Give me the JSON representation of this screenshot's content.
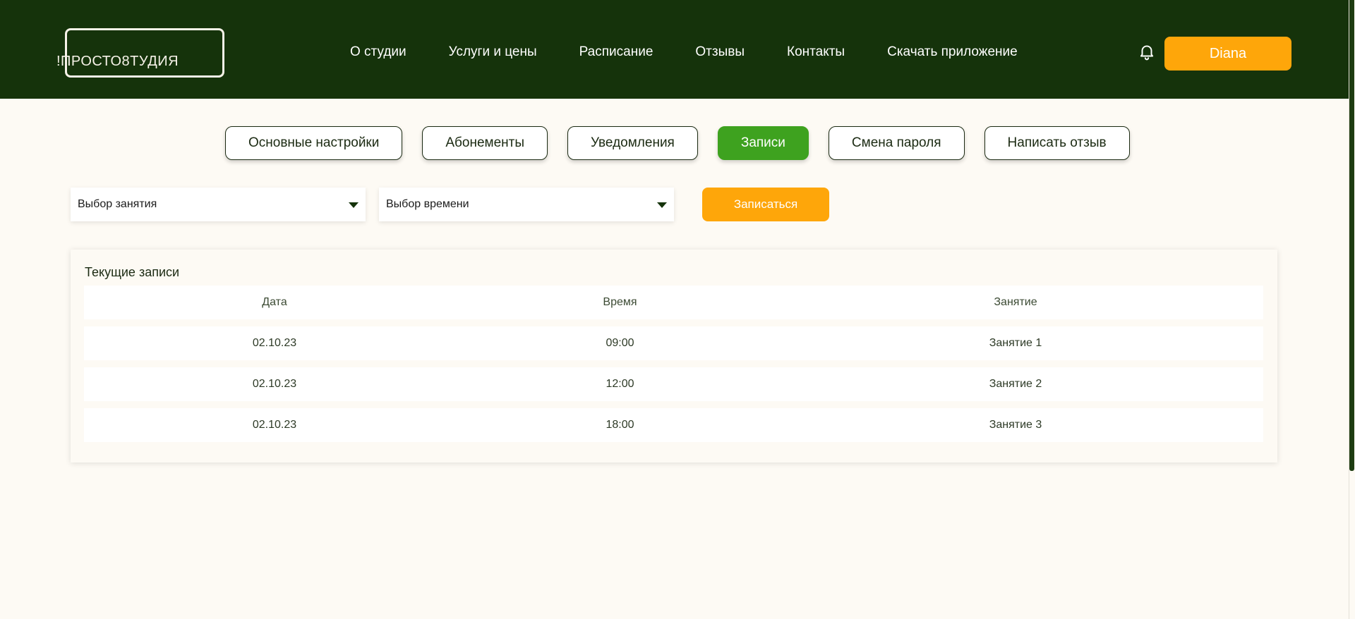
{
  "header": {
    "logo_text": "!ПРОСТО8ТУДИЯ",
    "nav": [
      {
        "label": "О студии"
      },
      {
        "label": "Услуги и цены"
      },
      {
        "label": "Расписание"
      },
      {
        "label": "Отзывы"
      },
      {
        "label": "Контакты"
      },
      {
        "label": "Скачать приложение"
      }
    ],
    "bell_icon": "bell-icon",
    "user_label": "Diana"
  },
  "tabs": [
    {
      "label": "Основные настройки",
      "active": false
    },
    {
      "label": "Абонементы",
      "active": false
    },
    {
      "label": "Уведомления",
      "active": false
    },
    {
      "label": "Записи",
      "active": true
    },
    {
      "label": "Смена пароля",
      "active": false
    },
    {
      "label": "Написать отзыв",
      "active": false
    }
  ],
  "booking": {
    "class_select": "Выбор занятия",
    "time_select": "Выбор времени",
    "submit_label": "Записаться"
  },
  "bookings": {
    "title": "Текущие записи",
    "columns": [
      "Дата",
      "Время",
      "Занятие"
    ],
    "rows": [
      [
        "02.10.23",
        "09:00",
        "Занятие 1"
      ],
      [
        "02.10.23",
        "12:00",
        "Занятие 2"
      ],
      [
        "02.10.23",
        "18:00",
        "Занятие 3"
      ]
    ]
  },
  "colors": {
    "header_bg": "#15330b",
    "accent_orange": "#fea60a",
    "active_green": "#3ea21f",
    "page_bg": "#fdfaf4"
  }
}
